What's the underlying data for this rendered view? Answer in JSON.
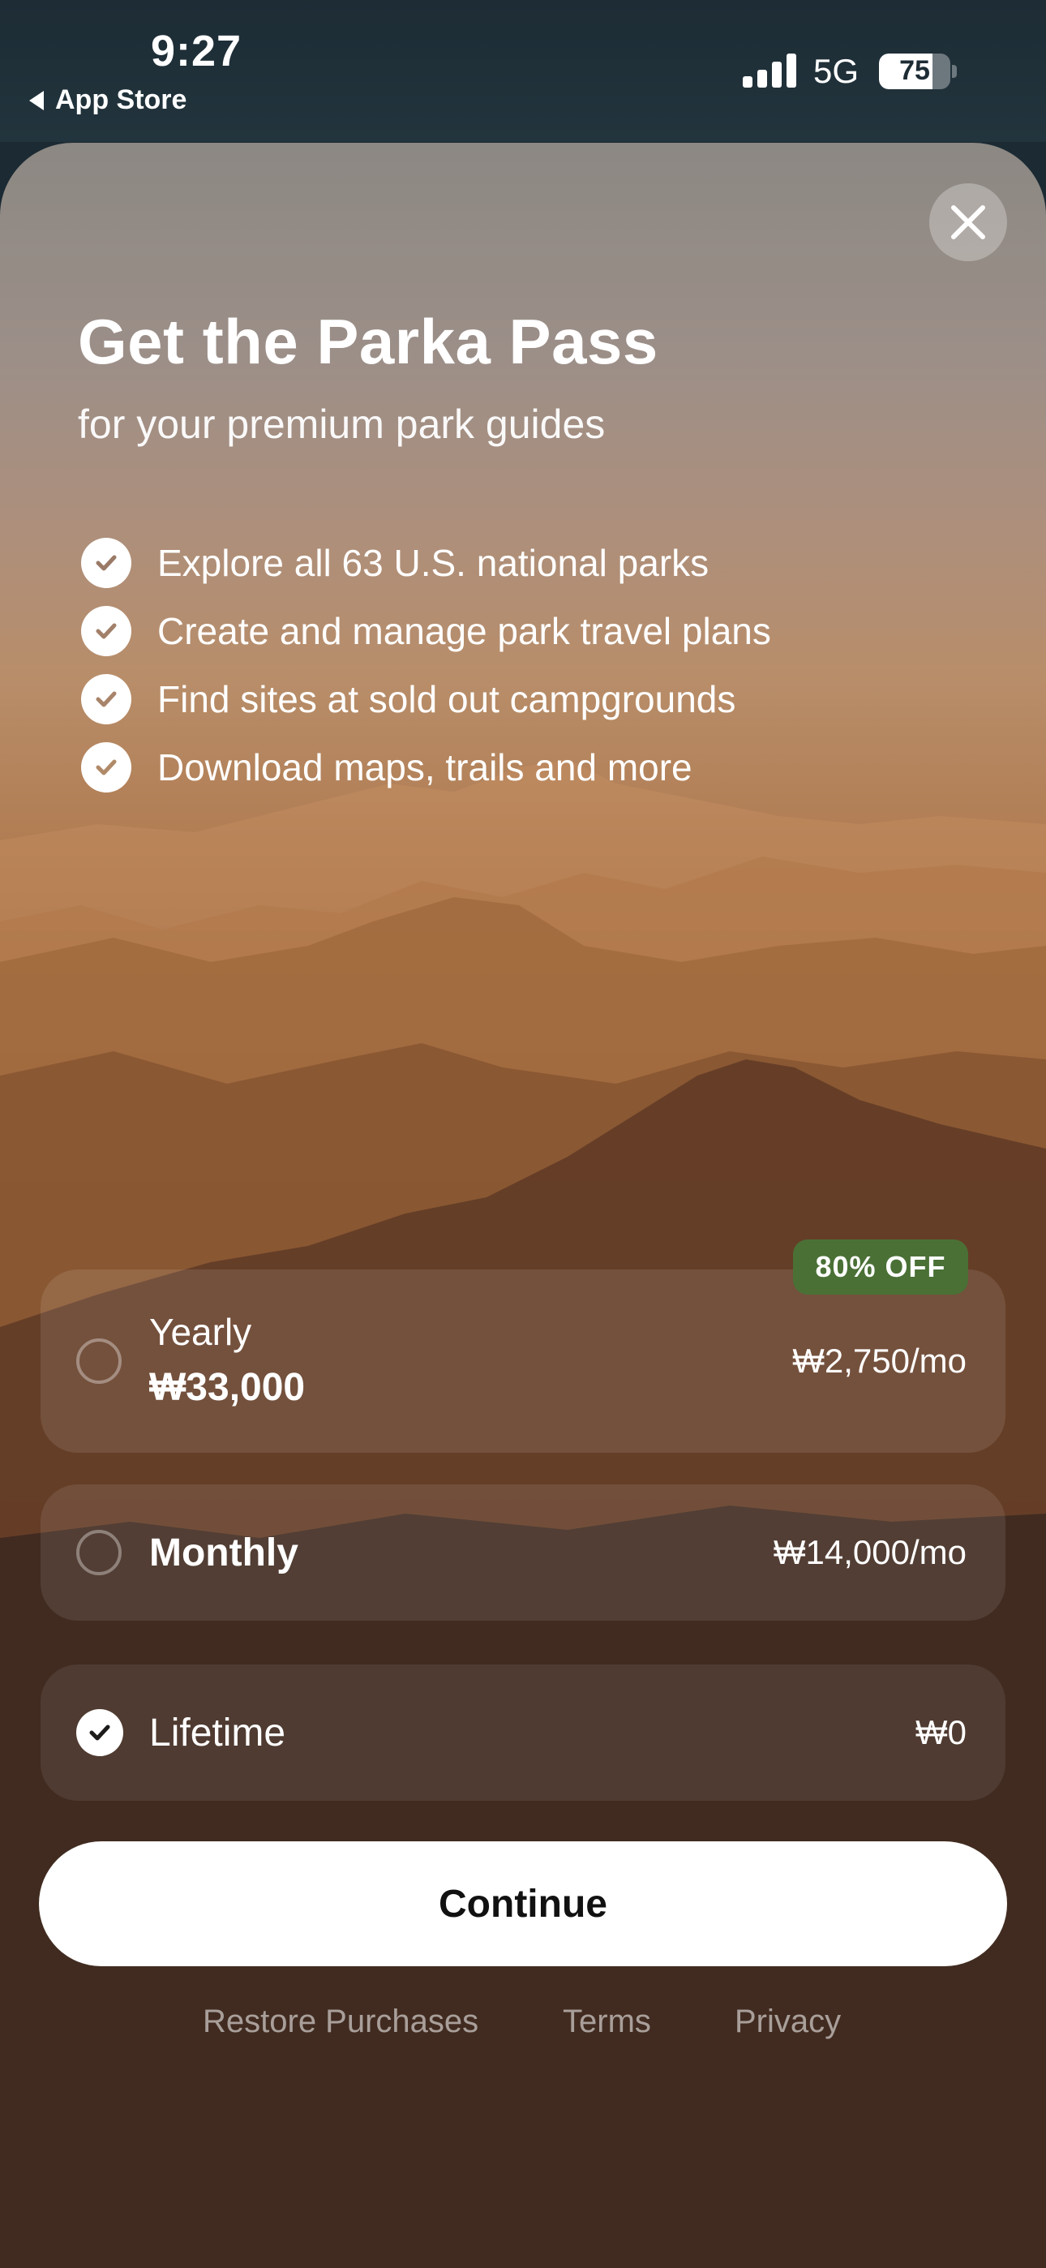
{
  "status_bar": {
    "time": "9:27",
    "back_label": "App Store",
    "network": "5G",
    "battery": "75",
    "battery_level": 0.75
  },
  "paywall": {
    "title": "Get the Parka Pass",
    "subtitle": "for your premium park guides",
    "features": [
      "Explore all 63 U.S. national parks",
      "Create and manage park travel plans",
      "Find sites at sold out campgrounds",
      "Download maps, trails and more"
    ],
    "plans": {
      "yearly": {
        "name": "Yearly",
        "price": "₩33,000",
        "per_month": "₩2,750/mo",
        "badge": "80% OFF",
        "selected": false
      },
      "monthly": {
        "name": "Monthly",
        "per_month": "₩14,000/mo",
        "selected": false
      },
      "lifetime": {
        "name": "Lifetime",
        "price": "₩0",
        "selected": true
      }
    },
    "continue_label": "Continue",
    "footer": {
      "restore": "Restore Purchases",
      "terms": "Terms",
      "privacy": "Privacy"
    }
  },
  "colors": {
    "badge_green": "#4a7036",
    "button_bg": "#ffffff",
    "status_bar_bg": "#1d2c35"
  },
  "icons": {
    "close": "close-icon",
    "check": "checkmark-icon",
    "back": "back-triangle-icon",
    "signal": "cellular-signal-icon",
    "battery": "battery-icon"
  }
}
